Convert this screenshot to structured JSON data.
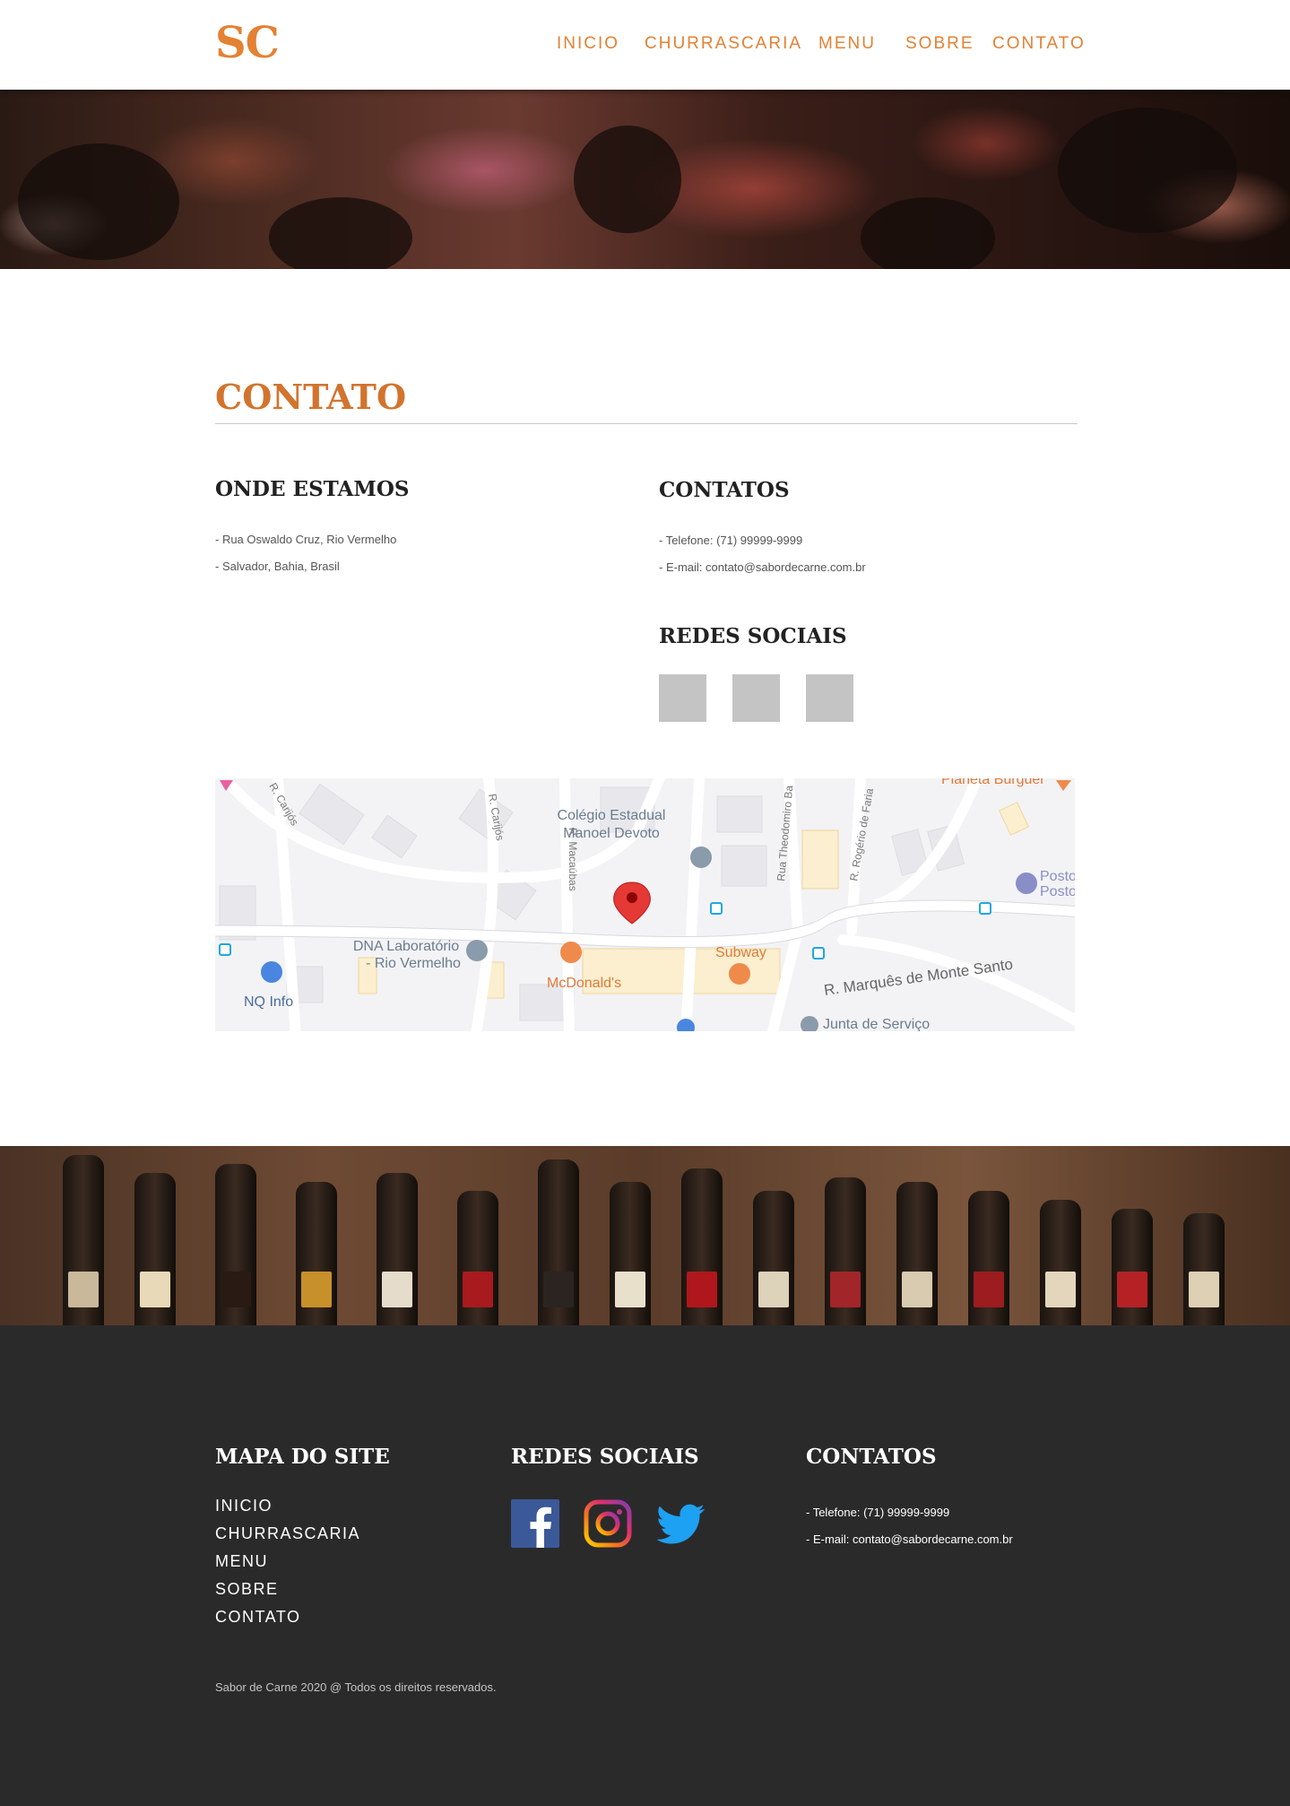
{
  "header": {
    "logo": "SC",
    "nav": [
      "INICIO",
      "CHURRASCARIA",
      "MENU",
      "SOBRE",
      "CONTATO"
    ]
  },
  "contact": {
    "title": "CONTATO",
    "location": {
      "heading": "ONDE ESTAMOS",
      "lines": [
        "- Rua Oswaldo Cruz, Rio Vermelho",
        "- Salvador, Bahia, Brasil"
      ]
    },
    "contacts": {
      "heading": "CONTATOS",
      "lines": [
        "- Telefone: (71) 99999-9999",
        "- E-mail: contato@sabordecarne.com.br"
      ]
    },
    "social": {
      "heading": "REDES SOCIAIS",
      "icons": [
        "facebook-placeholder",
        "instagram-placeholder",
        "twitter-placeholder"
      ]
    }
  },
  "map": {
    "labels": {
      "school": "Colégio Estadual\nManoel Devoto",
      "school_l1": "Colégio Estadual",
      "school_l2": "Manoel Devoto",
      "lab_l1": "DNA Laboratório",
      "lab_l2": "- Rio Vermelho",
      "nq": "NQ Info",
      "mcd": "McDonald's",
      "subway": "Subway",
      "street_main": "R. Marquês de Monte Santo",
      "junta": "Junta de Serviço",
      "planeta": "Planeta Burguer",
      "posto1": "Posto",
      "posto2": "Posto",
      "r_carijos1": "R. Carijós",
      "r_carijos2": "R. Carijós",
      "r_macaubas": "R. Macaúbas",
      "rua_theodomiro": "Rua Theodomiro Ba",
      "r_rogerio": "R. Rogério de Faria"
    },
    "colors": {
      "marker": "#e53935",
      "road": "#ffffff",
      "block": "#e9e9ec",
      "poi_orange": "#f08a4b",
      "poi_blue": "#5b8fd6"
    }
  },
  "footer": {
    "sitemap": {
      "heading": "MAPA DO SITE",
      "links": [
        "INICIO",
        "CHURRASCARIA",
        "MENU",
        "SOBRE",
        "CONTATO"
      ]
    },
    "social": {
      "heading": "REDES SOCIAIS",
      "icons": [
        "facebook-icon",
        "instagram-icon",
        "twitter-icon"
      ]
    },
    "contacts": {
      "heading": "CONTATOS",
      "lines": [
        "- Telefone: (71) 99999-9999",
        "- E-mail: contato@sabordecarne.com.br"
      ]
    },
    "copyright": "Sabor de Carne 2020 @ Todos os direitos reservados."
  },
  "colors": {
    "accent": "#e48133",
    "title": "#d2742d",
    "footer_bg": "#2b2a2b",
    "placeholder": "#c4c4c4"
  }
}
